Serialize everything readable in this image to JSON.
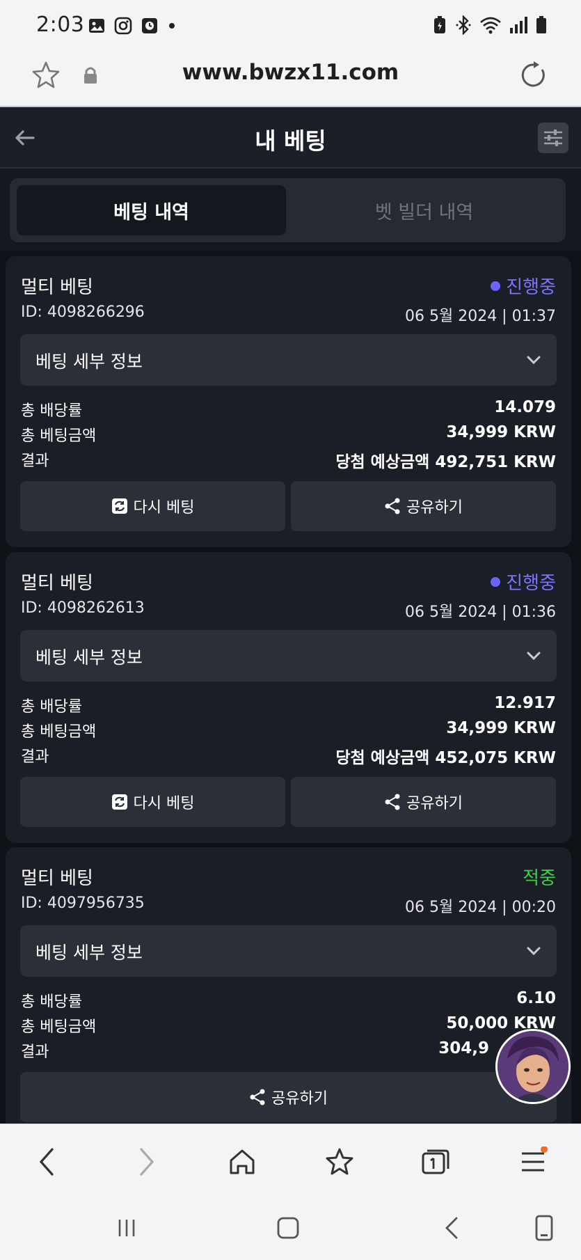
{
  "status_bar": {
    "time": "2:03"
  },
  "browser": {
    "url": "www.bwzx11.com"
  },
  "header": {
    "title": "내 베팅"
  },
  "tabs": [
    {
      "label": "베팅 내역",
      "active": true
    },
    {
      "label": "벳 빌더 내역",
      "active": false
    }
  ],
  "cards": [
    {
      "type": "멀티 베팅",
      "status": "진행중",
      "id": "ID: 4098266296",
      "date": "06 5월 2024 | 01:37",
      "details_label": "베팅 세부 정보",
      "total_odds_label": "총 배당률",
      "total_odds": "14.079",
      "total_stake_label": "총 베팅금액",
      "total_stake": "34,999 KRW",
      "result_label": "결과",
      "result": "당첨 예상금액 492,751 KRW",
      "rebet_label": "다시 베팅",
      "share_label": "공유하기"
    },
    {
      "type": "멀티 베팅",
      "status": "진행중",
      "id": "ID: 4098262613",
      "date": "06 5월 2024 | 01:36",
      "details_label": "베팅 세부 정보",
      "total_odds_label": "총 배당률",
      "total_odds": "12.917",
      "total_stake_label": "총 베팅금액",
      "total_stake": "34,999 KRW",
      "result_label": "결과",
      "result": "당첨 예상금액 452,075 KRW",
      "rebet_label": "다시 베팅",
      "share_label": "공유하기"
    },
    {
      "type": "멀티 베팅",
      "status": "적중",
      "id": "ID: 4097956735",
      "date": "06 5월 2024 | 00:20",
      "details_label": "베팅 세부 정보",
      "total_odds_label": "총 배당률",
      "total_odds": "6.10",
      "total_stake_label": "총 베팅금액",
      "total_stake": "50,000 KRW",
      "result_label": "결과",
      "result": "304,9",
      "share_label": "공유하기"
    }
  ],
  "colors": {
    "active_status": "#7b74ff",
    "won_status": "#3fcf4a",
    "background": "#0e1116",
    "card": "#1a1e26"
  },
  "icons": [
    "image-icon",
    "instagram-icon",
    "clock-app-icon",
    "battery-saver-icon",
    "bluetooth-icon",
    "wifi-icon",
    "signal-icon",
    "battery-icon"
  ]
}
